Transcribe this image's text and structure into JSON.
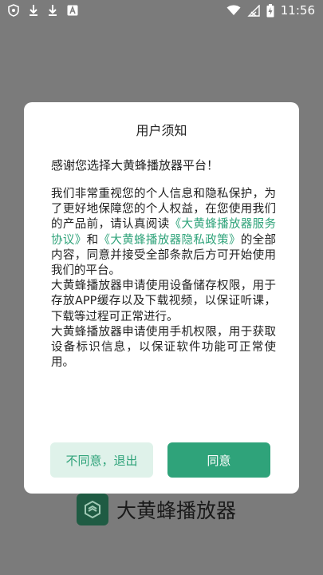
{
  "status_bar": {
    "time": "11:56",
    "icons": [
      "shield-icon",
      "download-icon",
      "download-icon",
      "app-a-icon",
      "wifi-icon",
      "signal-icon",
      "battery-charging-icon"
    ]
  },
  "background_brand": {
    "name": "大黄蜂播放器",
    "logo_color": "#1f5b43"
  },
  "dialog": {
    "title": "用户须知",
    "greeting": "感谢您选择大黄蜂播放器平台！",
    "body": {
      "p1_a": "我们非常重视您的个人信息和隐私保护，为了更好地保障您的个人权益，在您使用我们的产品前，请认真阅读",
      "link_service": "《大黄蜂播放器服务协议》",
      "and_text": "和",
      "link_privacy": "《大黄蜂播放器隐私政策》",
      "p1_b": "的全部内容，同意并接受全部条款后方可开始使用我们的平台。",
      "p2": "大黄蜂播放器申请使用设备储存权限，用于存放APP缓存以及下载视频，以保证听课，下载等过程可正常进行。",
      "p3": "大黄蜂播放器申请使用手机权限，用于获取设备标识信息，以保证软件功能可正常使用。"
    },
    "buttons": {
      "disagree": "不同意，退出",
      "agree": "同意"
    },
    "colors": {
      "accent": "#2fa37a",
      "accent_light": "#dff2ea"
    }
  }
}
